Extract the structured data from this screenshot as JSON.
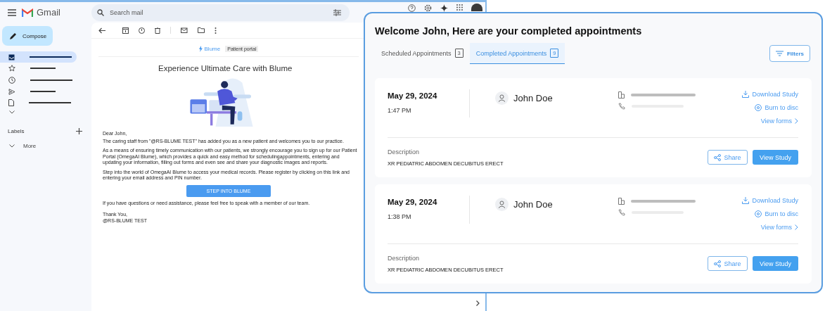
{
  "gmail": {
    "product_name": "Gmail",
    "search": {
      "placeholder": "Search mail"
    },
    "compose": "Compose",
    "nav_items": [
      {
        "kind": "inbox",
        "selected": true
      },
      {
        "kind": "starred",
        "selected": false
      },
      {
        "kind": "snoozed",
        "selected": false
      },
      {
        "kind": "sent",
        "selected": false
      },
      {
        "kind": "drafts",
        "selected": false
      }
    ],
    "labels_heading": "Labels",
    "more": "More"
  },
  "email": {
    "brand": "Blume",
    "badge": "Patient portal",
    "headline": "Experience Ultimate Care with Blume",
    "greeting": "Dear John,",
    "paragraphs": [
      "The caring staff from \"@RS-BLUME TEST\" has added you as a new patient and welcomes you to our practice.",
      "As a means of ensuring timely communication with our patients, we strongly encourage you to sign up for our Patient Portal (OmegaAI Blume), which provides a quick and easy method for schedulingappointments, entering and updating your information, filling out forms and even see and share your diagnostic images and reports.",
      "Step into the world of OmegaAI Blume to access your medical records. Please register by clicking on this link and entering your email address and PIN number."
    ],
    "cta": "STEP INTO BLUME",
    "closing": "If you have questions or need assistance, please feel free to speak with a member of our team.",
    "signoff": "Thank You,",
    "signature": "@RS-BLUME TEST"
  },
  "portal": {
    "title": "Welcome John, Here are your completed appointments",
    "tabs": [
      {
        "label": "Scheduled Appointments",
        "count": "3",
        "selected": false
      },
      {
        "label": "Completed Appointments",
        "count": "9",
        "selected": true
      }
    ],
    "filters": "Filters",
    "appointments": [
      {
        "date": "May 29, 2024",
        "time": "1:47 PM",
        "patient": "John Doe",
        "download": "Download Study",
        "burn": "Burn to disc",
        "forms": "View forms",
        "description_label": "Description",
        "description": "XR PEDIATRIC ABDOMEN DECUBITUS ERECT",
        "share": "Share",
        "view": "View Study"
      },
      {
        "date": "May 29, 2024",
        "time": "1:38 PM",
        "patient": "John Doe",
        "download": "Download Study",
        "burn": "Burn to disc",
        "forms": "View forms",
        "description_label": "Description",
        "description": "XR PEDIATRIC ABDOMEN DECUBITUS ERECT",
        "share": "Share",
        "view": "View Study"
      }
    ]
  }
}
